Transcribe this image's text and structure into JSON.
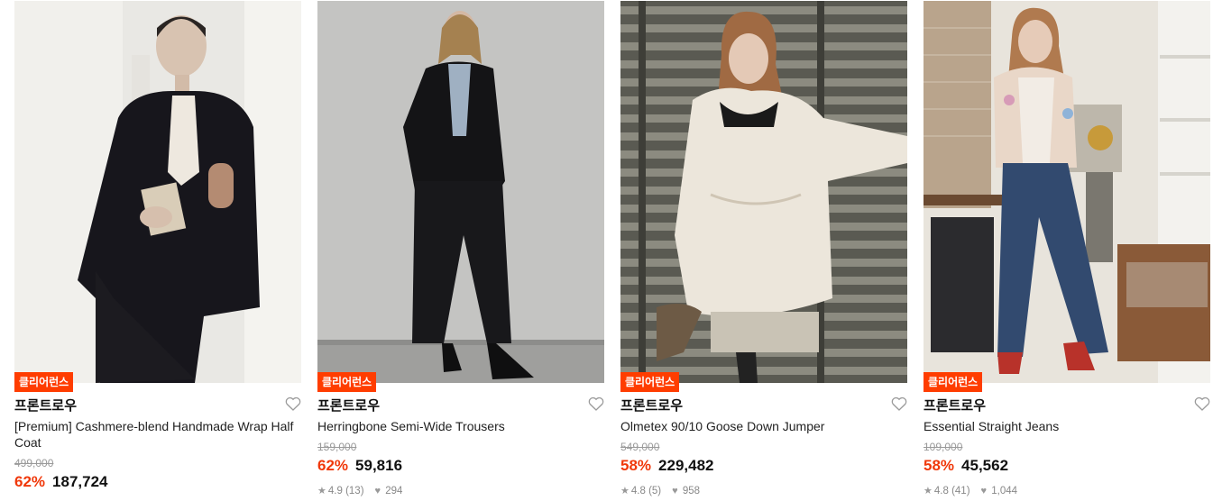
{
  "products": [
    {
      "badge": "클리어런스",
      "brand": "프론트로우",
      "title": "[Premium] Cashmere-blend Handmade Wrap Half Coat",
      "original_price": "499,000",
      "discount": "62%",
      "price": "187,724",
      "rating": "",
      "reviews": "",
      "likes": ""
    },
    {
      "badge": "클리어런스",
      "brand": "프론트로우",
      "title": "Herringbone Semi-Wide Trousers",
      "original_price": "159,000",
      "discount": "62%",
      "price": "59,816",
      "rating": "4.9",
      "reviews": "(13)",
      "likes": "294"
    },
    {
      "badge": "클리어런스",
      "brand": "프론트로우",
      "title": "Olmetex 90/10 Goose Down Jumper",
      "original_price": "549,000",
      "discount": "58%",
      "price": "229,482",
      "rating": "4.8",
      "reviews": "(5)",
      "likes": "958"
    },
    {
      "badge": "클리어런스",
      "brand": "프론트로우",
      "title": "Essential Straight Jeans",
      "original_price": "109,000",
      "discount": "58%",
      "price": "45,562",
      "rating": "4.8",
      "reviews": "(41)",
      "likes": "1,044"
    }
  ],
  "icons": {
    "wishlist": "heart-outline-icon",
    "rating": "star-icon",
    "likes": "heart-filled-icon"
  },
  "colors": {
    "badge_bg": "#ff3d00",
    "discount": "#f0380a",
    "muted": "#9a9a9a"
  }
}
